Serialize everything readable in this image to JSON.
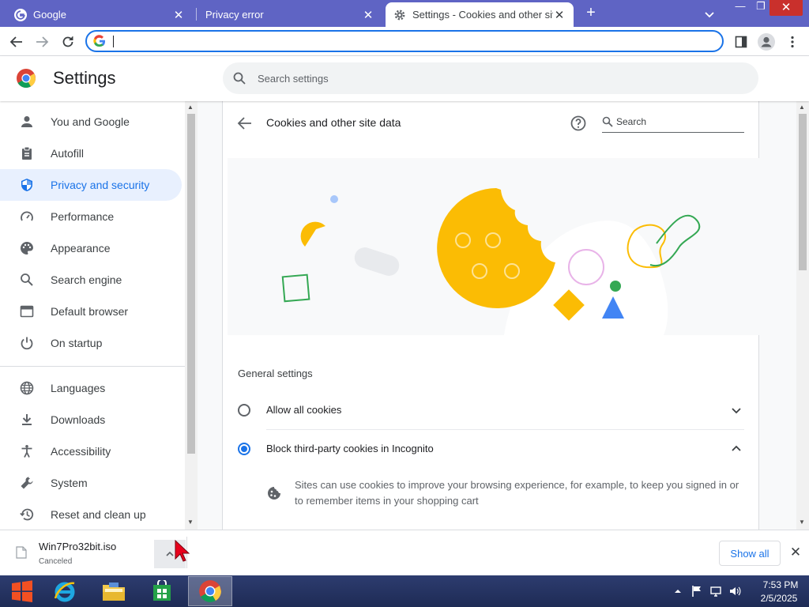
{
  "browser": {
    "tabs": [
      {
        "title": "Google",
        "favicon": "google-g-icon",
        "active": false
      },
      {
        "title": "Privacy error",
        "favicon": "",
        "active": false
      },
      {
        "title": "Settings - Cookies and other site data",
        "favicon": "gear-icon",
        "active": true
      }
    ],
    "window_controls": {
      "minimize": "—",
      "maximize": "❐",
      "close": "✕"
    },
    "new_tab_label": "+",
    "omnibox": {
      "value": "",
      "placeholder": ""
    },
    "accent_color": "#1a73e8",
    "tabstrip_color": "#5f64c4"
  },
  "settings": {
    "title": "Settings",
    "search_placeholder": "Search settings",
    "nav": [
      {
        "label": "You and Google",
        "icon": "person-icon",
        "selected": false
      },
      {
        "label": "Autofill",
        "icon": "clipboard-icon",
        "selected": false
      },
      {
        "label": "Privacy and security",
        "icon": "shield-icon",
        "selected": true
      },
      {
        "label": "Performance",
        "icon": "speedometer-icon",
        "selected": false
      },
      {
        "label": "Appearance",
        "icon": "palette-icon",
        "selected": false
      },
      {
        "label": "Search engine",
        "icon": "search-icon",
        "selected": false
      },
      {
        "label": "Default browser",
        "icon": "browser-window-icon",
        "selected": false
      },
      {
        "label": "On startup",
        "icon": "power-icon",
        "selected": false
      },
      {
        "label": "Languages",
        "icon": "globe-icon",
        "selected": false
      },
      {
        "label": "Downloads",
        "icon": "download-icon",
        "selected": false
      },
      {
        "label": "Accessibility",
        "icon": "accessibility-icon",
        "selected": false
      },
      {
        "label": "System",
        "icon": "wrench-icon",
        "selected": false
      },
      {
        "label": "Reset and clean up",
        "icon": "history-icon",
        "selected": false
      }
    ]
  },
  "page": {
    "heading": "Cookies and other site data",
    "search_placeholder": "Search",
    "general_settings_heading": "General settings",
    "options": [
      {
        "label": "Allow all cookies",
        "selected": false,
        "expanded": false
      },
      {
        "label": "Block third-party cookies in Incognito",
        "selected": true,
        "expanded": true
      }
    ],
    "expanded_description": "Sites can use cookies to improve your browsing experience, for example, to keep you signed in or to remember items in your shopping cart"
  },
  "download_shelf": {
    "filename": "Win7Pro32bit.iso",
    "status": "Canceled",
    "show_all_label": "Show all",
    "close_label": "✕"
  },
  "taskbar": {
    "apps": [
      "windows-start-icon",
      "internet-explorer-icon",
      "file-explorer-icon",
      "windows-store-icon",
      "chrome-icon"
    ],
    "time": "7:53 PM",
    "date": "2/5/2025"
  }
}
